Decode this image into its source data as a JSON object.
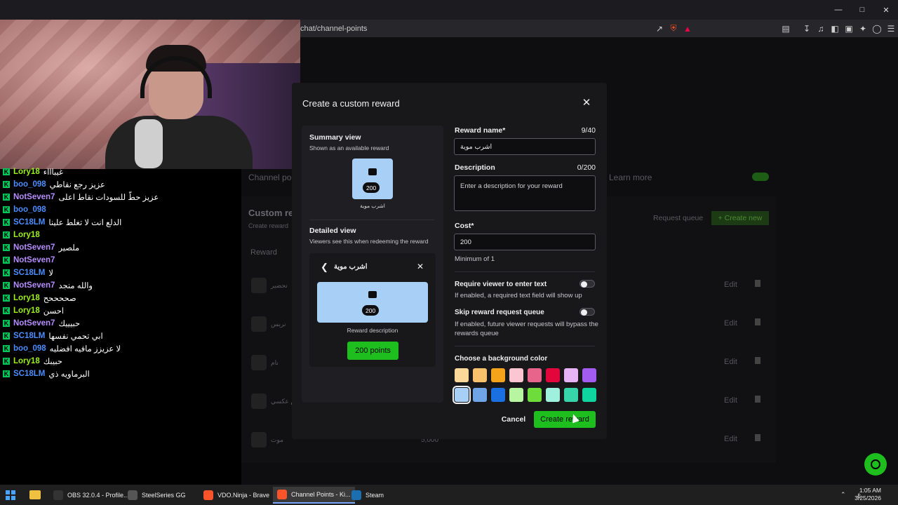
{
  "browser": {
    "url": "chat/channel-points",
    "window_controls": [
      "minimize-icon",
      "maximize-icon",
      "close-icon"
    ]
  },
  "chat": {
    "messages": [
      {
        "user": "Lory18",
        "text": "غيباااء",
        "color": "#9ef01a"
      },
      {
        "user": "boo_098",
        "text": "عزيز رجع نقاطي",
        "color": "#4c8dff"
      },
      {
        "user": "NotSeven7",
        "text": "عزيز حطّ للسودات نقاط اعلى",
        "color": "#b68cff"
      },
      {
        "user": "boo_098",
        "text": "",
        "color": "#4c8dff"
      },
      {
        "user": "SC18LM",
        "text": "الدلع انت لا تغلط علينا",
        "color": "#4c8dff"
      },
      {
        "user": "Lory18",
        "text": "",
        "color": "#9ef01a"
      },
      {
        "user": "NotSeven7",
        "text": "ملصير",
        "color": "#b68cff"
      },
      {
        "user": "NotSeven7",
        "text": "",
        "color": "#b68cff"
      },
      {
        "user": "SC18LM",
        "text": "لا",
        "color": "#4c8dff"
      },
      {
        "user": "NotSeven7",
        "text": "والله منجد",
        "color": "#b68cff"
      },
      {
        "user": "Lory18",
        "text": "صححححح",
        "color": "#9ef01a"
      },
      {
        "user": "Lory18",
        "text": "احسن",
        "color": "#9ef01a"
      },
      {
        "user": "NotSeven7",
        "text": "حبيييك",
        "color": "#b68cff"
      },
      {
        "user": "SC18LM",
        "text": "ابي تحمي نفسها",
        "color": "#4c8dff"
      },
      {
        "user": "boo_098",
        "text": "لا عزيزز مافيه افضليه",
        "color": "#4c8dff"
      },
      {
        "user": "Lory18",
        "text": "حبيبك",
        "color": "#9ef01a"
      },
      {
        "user": "SC18LM",
        "text": "البرماويه ذي",
        "color": "#4c8dff"
      }
    ]
  },
  "background_page": {
    "channel_points_label": "Channel poi",
    "learn_more": "Learn more",
    "custom_rewards_title": "Custom re",
    "create_reward_sub": "Create reward",
    "reward_header": "Reward",
    "request_queue": "Request queue",
    "create_new": "+ Create new",
    "rows": [
      {
        "name": "تحضير",
        "cost": "",
        "edit": "Edit"
      },
      {
        "name": "نريس",
        "cost": "",
        "edit": "Edit"
      },
      {
        "name": "نام",
        "cost": "",
        "edit": "Edit"
      },
      {
        "name": "نام عكسي",
        "cost": "",
        "edit": "Edit"
      },
      {
        "name": "موت",
        "cost": "5,000",
        "edit": "Edit"
      }
    ]
  },
  "modal": {
    "title": "Create a custom reward",
    "summary_view": {
      "heading": "Summary view",
      "subtitle": "Shown as an available reward",
      "cost": "200",
      "name": "اشرب موية"
    },
    "detailed_view": {
      "heading": "Detailed view",
      "subtitle": "Viewers see this when redeeming the reward",
      "name": "اشرب موية",
      "cost": "200",
      "description": "Reward description",
      "points_button": "200 points"
    },
    "form": {
      "reward_name_label": "Reward name*",
      "reward_name_count": "9/40",
      "reward_name_value": "اشرب موية",
      "description_label": "Description",
      "description_count": "0/200",
      "description_placeholder": "Enter a description for your reward",
      "cost_label": "Cost*",
      "cost_value": "200",
      "cost_hint": "Minimum of 1",
      "require_text_label": "Require viewer to enter text",
      "require_text_hint": "If enabled, a required text field will show up",
      "skip_queue_label": "Skip reward request queue",
      "skip_queue_hint": "If enabled, future viewer requests will bypass the rewards queue",
      "bg_color_label": "Choose a background color",
      "colors_row1": [
        "#fcd79a",
        "#f7c26b",
        "#f5a31a",
        "#fbc6d2",
        "#e8648a",
        "#e3063c",
        "#e6b3f7",
        "#a35cf0"
      ],
      "colors_row2": [
        "#a8cff5",
        "#6fa5e6",
        "#1a70e0",
        "#b8f5a0",
        "#6edc3a",
        "#9ff0dc",
        "#36d4a8",
        "#10d4a0"
      ],
      "selected_color_index": 8,
      "cancel": "Cancel",
      "create": "Create reward"
    }
  },
  "taskbar": {
    "items": [
      {
        "label": "OBS 32.0.4 - Profile...",
        "icon": "obs-icon",
        "active": false
      },
      {
        "label": "SteelSeries GG",
        "icon": "steelseries-icon",
        "active": false
      },
      {
        "label": "VDO.Ninja - Brave",
        "icon": "brave-icon",
        "active": false
      },
      {
        "label": "Channel Points - Ki...",
        "icon": "brave-icon",
        "active": true
      },
      {
        "label": "Steam",
        "icon": "steam-icon",
        "active": false
      }
    ],
    "time": "1:05 AM",
    "date": "3/25/2026"
  }
}
